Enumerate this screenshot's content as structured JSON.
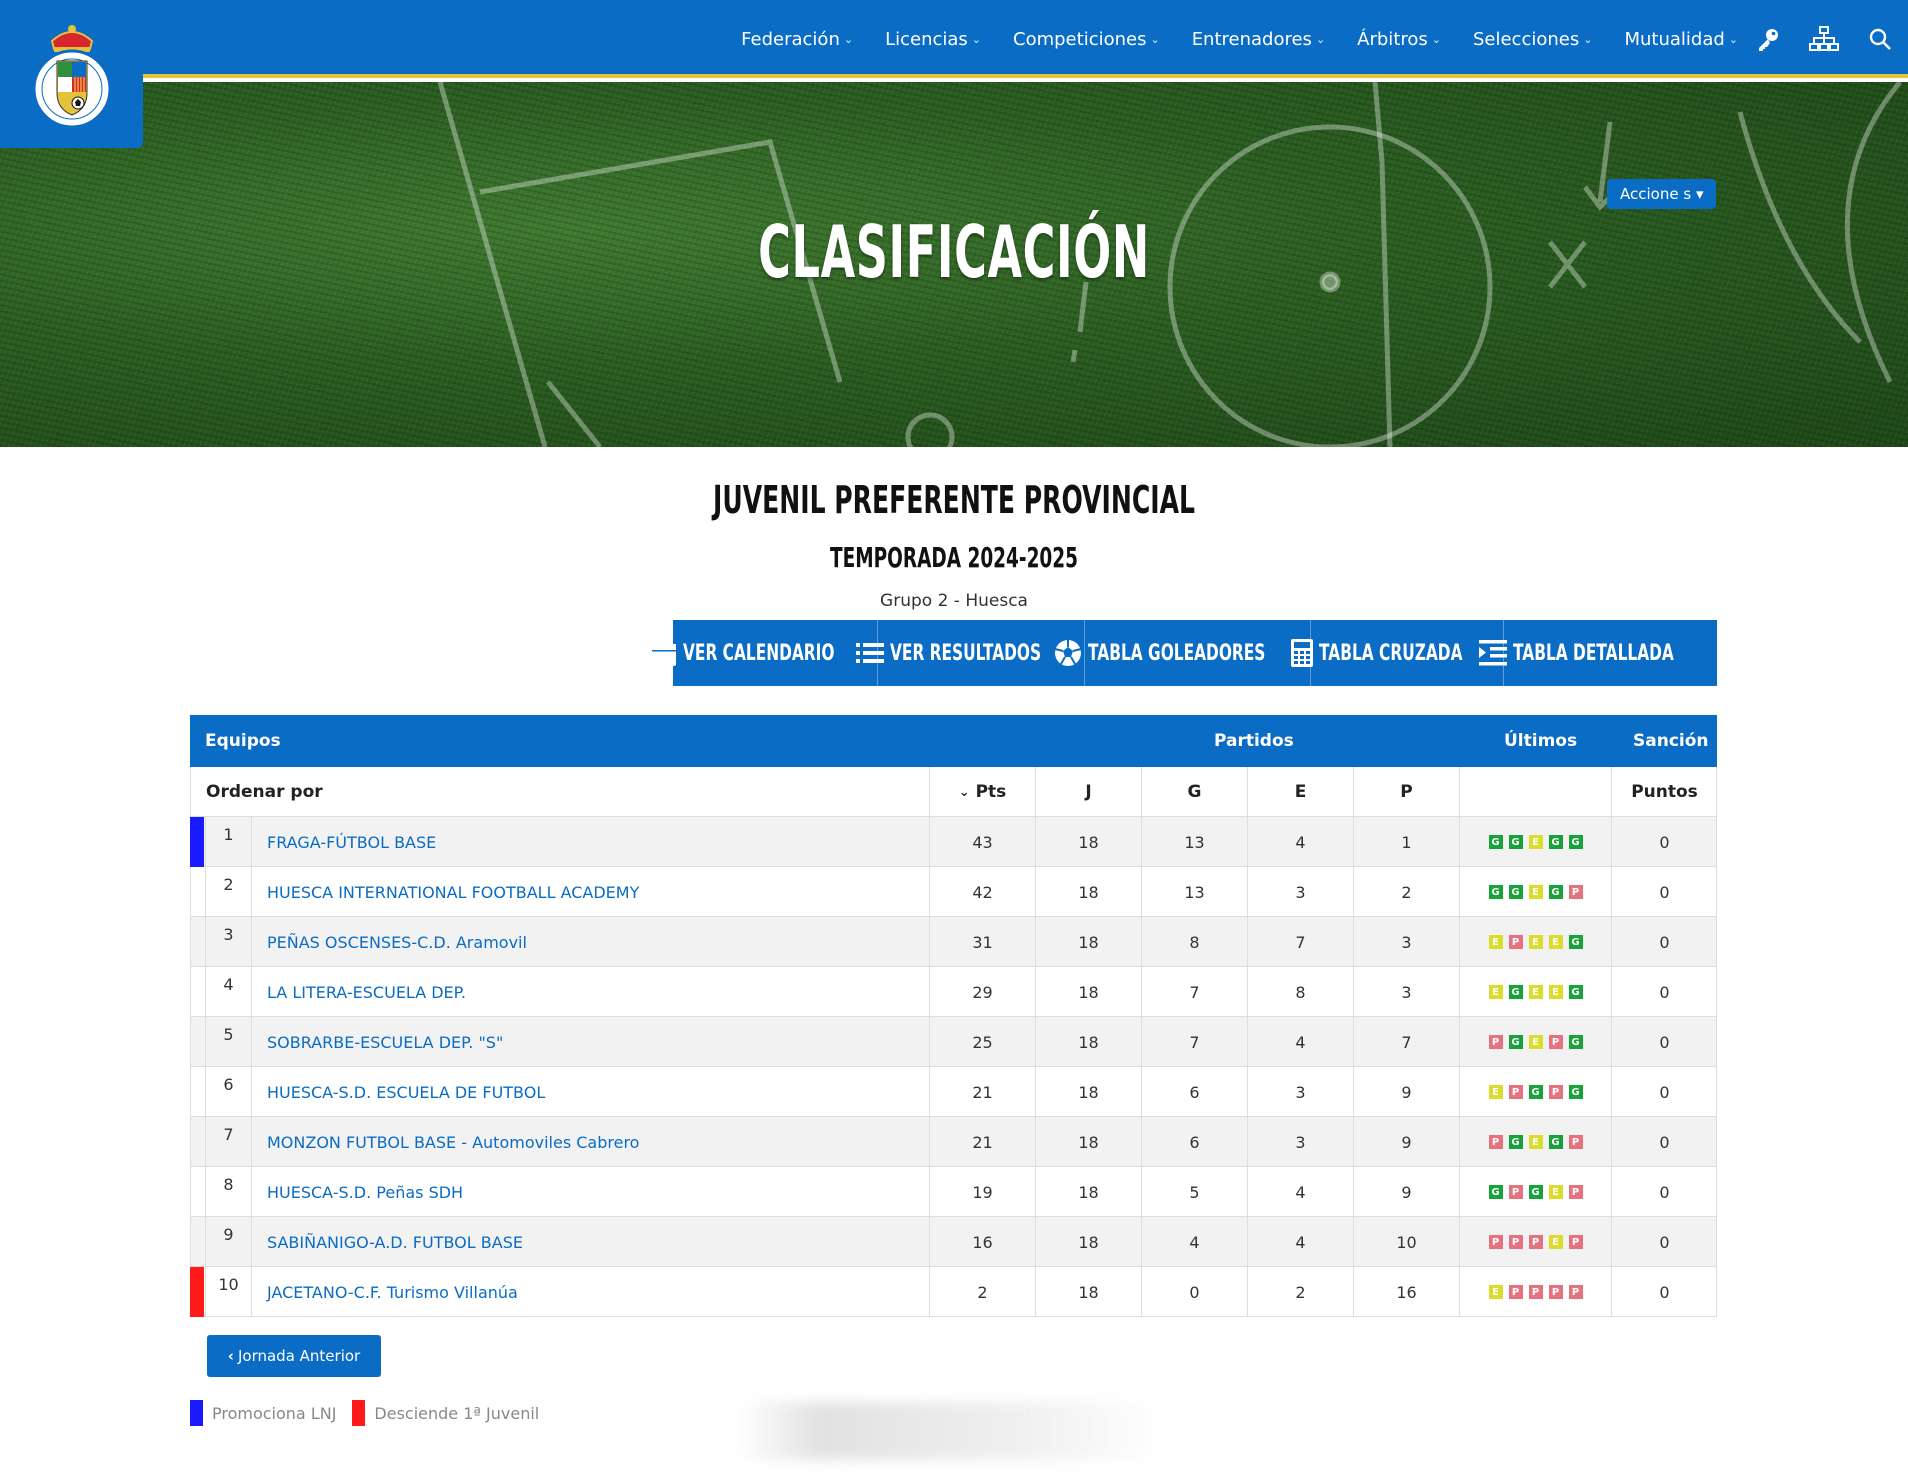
{
  "nav": {
    "items": [
      {
        "label": "Federación"
      },
      {
        "label": "Licencias"
      },
      {
        "label": "Competiciones"
      },
      {
        "label": "Entrenadores"
      },
      {
        "label": "Árbitros"
      },
      {
        "label": "Selecciones"
      },
      {
        "label": "Mutualidad"
      }
    ],
    "icons": [
      "key-icon",
      "sitemap-icon",
      "search-icon"
    ]
  },
  "hero": {
    "title": "CLASIFICACIÓN",
    "actions_label": "Accione s"
  },
  "competition": {
    "title": "JUVENIL PREFERENTE PROVINCIAL",
    "season": "TEMPORADA 2024-2025",
    "group": "Grupo 2 - Huesca"
  },
  "toolbar": {
    "calendar": "VER CALENDARIO",
    "results": "VER RESULTADOS",
    "scorers": "TABLA GOLEADORES",
    "cross": "TABLA CRUZADA",
    "detailed": "TABLA DETALLADA"
  },
  "table": {
    "group_headers": {
      "teams": "Equipos",
      "matches": "Partidos",
      "last": "Últimos",
      "sanction": "Sanción"
    },
    "sort_label": "Ordenar por",
    "columns": {
      "pts": "Pts",
      "j": "J",
      "g": "G",
      "e": "E",
      "p": "P",
      "points": "Puntos"
    },
    "rows": [
      {
        "pos": "1",
        "team": "FRAGA-FÚTBOL BASE",
        "pts": "43",
        "j": "18",
        "g": "13",
        "e": "4",
        "p": "1",
        "form": [
          "G",
          "G",
          "E",
          "G",
          "G"
        ],
        "sanction": "0",
        "mark": "promote"
      },
      {
        "pos": "2",
        "team": "HUESCA INTERNATIONAL FOOTBALL ACADEMY",
        "pts": "42",
        "j": "18",
        "g": "13",
        "e": "3",
        "p": "2",
        "form": [
          "G",
          "G",
          "E",
          "G",
          "P"
        ],
        "sanction": "0",
        "mark": ""
      },
      {
        "pos": "3",
        "team": "PEÑAS OSCENSES-C.D. Aramovil",
        "pts": "31",
        "j": "18",
        "g": "8",
        "e": "7",
        "p": "3",
        "form": [
          "E",
          "P",
          "E",
          "E",
          "G"
        ],
        "sanction": "0",
        "mark": ""
      },
      {
        "pos": "4",
        "team": "LA LITERA-ESCUELA DEP.",
        "pts": "29",
        "j": "18",
        "g": "7",
        "e": "8",
        "p": "3",
        "form": [
          "E",
          "G",
          "E",
          "E",
          "G"
        ],
        "sanction": "0",
        "mark": ""
      },
      {
        "pos": "5",
        "team": "SOBRARBE-ESCUELA DEP. \"S\"",
        "pts": "25",
        "j": "18",
        "g": "7",
        "e": "4",
        "p": "7",
        "form": [
          "P",
          "G",
          "E",
          "P",
          "G"
        ],
        "sanction": "0",
        "mark": ""
      },
      {
        "pos": "6",
        "team": "HUESCA-S.D. ESCUELA DE FUTBOL",
        "pts": "21",
        "j": "18",
        "g": "6",
        "e": "3",
        "p": "9",
        "form": [
          "E",
          "P",
          "G",
          "P",
          "G"
        ],
        "sanction": "0",
        "mark": ""
      },
      {
        "pos": "7",
        "team": "MONZON FUTBOL BASE - Automoviles Cabrero",
        "pts": "21",
        "j": "18",
        "g": "6",
        "e": "3",
        "p": "9",
        "form": [
          "P",
          "G",
          "E",
          "G",
          "P"
        ],
        "sanction": "0",
        "mark": ""
      },
      {
        "pos": "8",
        "team": "HUESCA-S.D. Peñas SDH",
        "pts": "19",
        "j": "18",
        "g": "5",
        "e": "4",
        "p": "9",
        "form": [
          "G",
          "P",
          "G",
          "E",
          "P"
        ],
        "sanction": "0",
        "mark": ""
      },
      {
        "pos": "9",
        "team": "SABIÑANIGO-A.D. FUTBOL BASE",
        "pts": "16",
        "j": "18",
        "g": "4",
        "e": "4",
        "p": "10",
        "form": [
          "P",
          "P",
          "P",
          "E",
          "P"
        ],
        "sanction": "0",
        "mark": ""
      },
      {
        "pos": "10",
        "team": "JACETANO-C.F. Turismo Villanúa",
        "pts": "2",
        "j": "18",
        "g": "0",
        "e": "2",
        "p": "16",
        "form": [
          "E",
          "P",
          "P",
          "P",
          "P"
        ],
        "sanction": "0",
        "mark": "relegate"
      }
    ]
  },
  "prev_button": "Jornada Anterior",
  "legend": {
    "promote": {
      "label": "Promociona LNJ",
      "color": "#1a1aff"
    },
    "relegate": {
      "label": "Desciende 1ª Juvenil",
      "color": "#ff1a1a"
    }
  },
  "colors": {
    "brand": "#0a6cc4",
    "accent": "#e4c23b",
    "win": "#17a33a",
    "draw": "#dbdc2b",
    "loss": "#e6727f"
  }
}
